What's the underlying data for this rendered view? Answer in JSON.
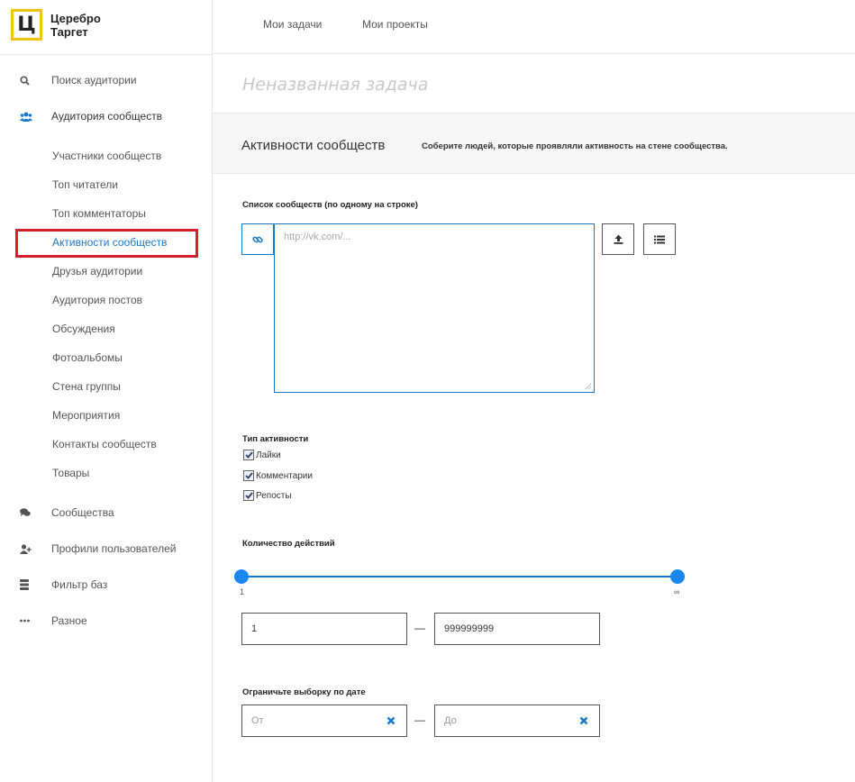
{
  "logo": {
    "mark": "Ц",
    "line1": "Церебро",
    "line2": "Таргет"
  },
  "topnav": {
    "tasks": "Мои задачи",
    "projects": "Мои проекты"
  },
  "sidebar": {
    "search": "Поиск аудитории",
    "communities_audience": "Аудитория сообществ",
    "sub_items": [
      "Участники сообществ",
      "Топ читатели",
      "Топ комментаторы",
      "Активности сообществ",
      "Друзья аудитории",
      "Аудитория постов",
      "Обсуждения",
      "Фотоальбомы",
      "Стена группы",
      "Мероприятия",
      "Контакты сообществ",
      "Товары"
    ],
    "communities": "Сообщества",
    "user_profiles": "Профили пользователей",
    "db_filter": "Фильтр баз",
    "misc": "Разное"
  },
  "main": {
    "task_title": "Неназванная задача",
    "section_title": "Активности сообществ",
    "section_desc": "Соберите людей, которые проявляли активность на стене сообщества.",
    "list_label": "Список сообществ (по одному на строке)",
    "list_placeholder": "http://vk.com/...",
    "activity_label": "Тип активности",
    "activity_types": [
      "Лайки",
      "Комментарии",
      "Репосты"
    ],
    "count_label": "Количество действий",
    "slider_min": "1",
    "slider_max": "∞",
    "count_from": "1",
    "count_to": "999999999",
    "range_dash": "—",
    "date_label": "Ограничьте выборку по дате",
    "date_from": "От",
    "date_to": "До"
  },
  "colors": {
    "accent": "#1b78c7",
    "logo_yellow": "#f2c20f",
    "highlight_red": "#d3202a"
  }
}
